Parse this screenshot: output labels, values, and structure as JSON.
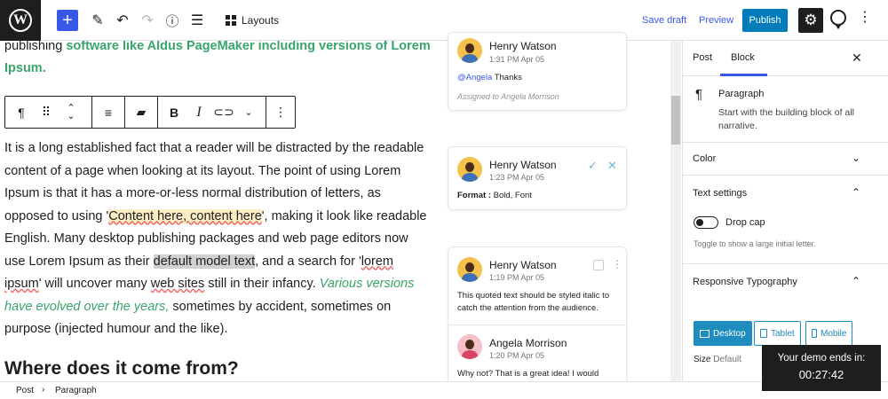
{
  "topbar": {
    "layouts_label": "Layouts",
    "save_draft": "Save draft",
    "preview": "Preview",
    "publish": "Publish"
  },
  "editor": {
    "intro_plain": "publishing ",
    "intro_bold": "software like Aldus PageMaker including versions of Lorem Ipsum.",
    "p1": "It is a long established fact that a reader will be distracted by the readable content of a page when looking at its layout. The point of using Lorem Ipsum is that it has a more-or-less normal distribution of letters, as opposed to using '",
    "p_hl1": "Content here, content here",
    "p2": "', making it look like readable English. Many desktop publishing packages and web page editors now use Lorem Ipsum as their ",
    "p_hl2": "default model text",
    "p3": ", and a search for '",
    "p_ul1": "lorem ipsum",
    "p4": "' will uncover many ",
    "p_ul2": "web sites",
    "p5": " still in their infancy. ",
    "p_ital": "Various versions have evolved over the years,",
    "p6": " sometimes by accident, sometimes on purpose (injected humour and the like).",
    "heading": "Where does it come from?"
  },
  "comments": [
    {
      "name": "Henry Watson",
      "time": "1:31 PM Apr 05",
      "mention": "@Angela",
      "text": " Thanks",
      "assigned": "Assigned to Angela Morrison"
    },
    {
      "name": "Henry Watson",
      "time": "1:23 PM Apr 05",
      "format_label": "Format :",
      "format_value": " Bold, Font"
    },
    {
      "name": "Henry Watson",
      "time": "1:19 PM Apr 05",
      "text": "This quoted text should be styled italic to catch the attention from the audience.",
      "reply_name": "Angela Morrison",
      "reply_time": "1:20 PM Apr 05",
      "reply_text": "Why not? That is a great idea! I would"
    }
  ],
  "sidebar": {
    "tab_post": "Post",
    "tab_block": "Block",
    "block_title": "Paragraph",
    "block_desc": "Start with the building block of all narrative.",
    "color": "Color",
    "text_settings": "Text settings",
    "drop_cap": "Drop cap",
    "drop_cap_help": "Toggle to show a large initial letter.",
    "responsive": "Responsive Typography",
    "desktop": "Desktop",
    "tablet": "Tablet",
    "mobile": "Mobile",
    "size_label": "Size",
    "size_value": "Default"
  },
  "footer": {
    "crumb1": "Post",
    "crumb2": "Paragraph"
  },
  "demo": {
    "line1": "Your demo ends in:",
    "countdown": "00:27:42"
  }
}
